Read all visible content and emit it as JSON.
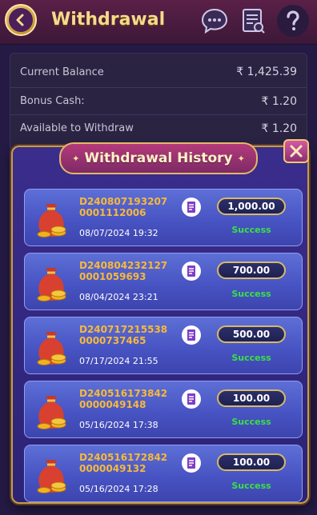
{
  "header": {
    "title": "Withdrawal",
    "icons": [
      "back-icon",
      "support-chat-icon",
      "records-icon",
      "help-icon"
    ]
  },
  "balance": {
    "current_label": "Current Balance",
    "current_value": "₹ 1,425.39",
    "bonus_label": "Bonus Cash:",
    "bonus_value": "₹ 1.20",
    "available_label": "Available to Withdraw",
    "available_value": "₹ 1.20"
  },
  "modal": {
    "title": "Withdrawal History",
    "close_icon": "close-icon"
  },
  "history": [
    {
      "txn": "D2408071932070001112006",
      "date": "08/07/2024 19:32",
      "amount": "1,000.00",
      "status": "Success"
    },
    {
      "txn": "D2408042321270001059693",
      "date": "08/04/2024 23:21",
      "amount": "700.00",
      "status": "Success"
    },
    {
      "txn": "D2407172155380000737465",
      "date": "07/17/2024 21:55",
      "amount": "500.00",
      "status": "Success"
    },
    {
      "txn": "D2405161738420000049148",
      "date": "05/16/2024 17:38",
      "amount": "100.00",
      "status": "Success"
    },
    {
      "txn": "D2405161728420000049132",
      "date": "05/16/2024 17:28",
      "amount": "100.00",
      "status": "Success"
    }
  ],
  "colors": {
    "accent_gold": "#f6d98a",
    "success": "#39e046",
    "txn_id": "#f6b93a"
  }
}
